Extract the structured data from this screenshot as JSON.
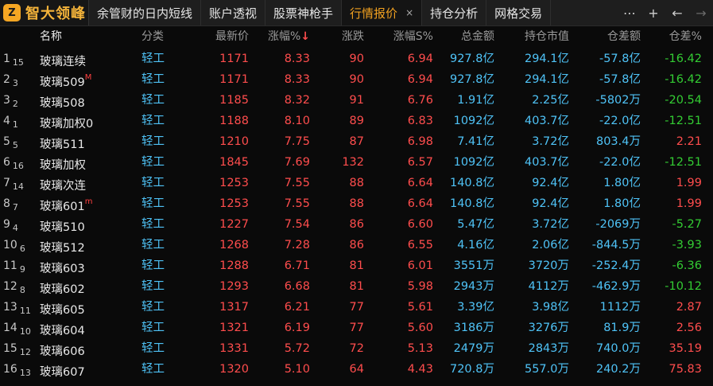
{
  "app": {
    "logo_text": "智大领峰",
    "logo_mark": "Z"
  },
  "tabs": [
    {
      "label": "余管财的日内短线",
      "active": false
    },
    {
      "label": "账户透视",
      "active": false
    },
    {
      "label": "股票神枪手",
      "active": false
    },
    {
      "label": "行情报价",
      "active": true,
      "close": "×"
    },
    {
      "label": "持仓分析",
      "active": false
    },
    {
      "label": "网格交易",
      "active": false
    }
  ],
  "toolbar": {
    "more": "⋯",
    "add": "+",
    "back": "←",
    "forward": "→"
  },
  "columns": {
    "name": "名称",
    "category": "分类",
    "price": "最新价",
    "change_pct": "涨幅%",
    "sort_indicator": "↓",
    "change": "涨跌",
    "amplitude": "涨幅S%",
    "amount": "总金额",
    "open_interest_value": "持仓市值",
    "oi_diff": "仓差额",
    "oi_change_pct": "仓差%"
  },
  "rows": [
    {
      "idx": "1",
      "sub": "15",
      "name": "玻璃连续",
      "mark": "",
      "cat": "轻工",
      "price": "1171",
      "pct": "8.33",
      "chg": "90",
      "amp": "6.94",
      "amount": "927.8亿",
      "oi": "294.1亿",
      "oidiff": "-57.8亿",
      "oichg": "-16.42",
      "oichg_dir": "down"
    },
    {
      "idx": "2",
      "sub": "3",
      "name": "玻璃509",
      "mark": "M",
      "cat": "轻工",
      "price": "1171",
      "pct": "8.33",
      "chg": "90",
      "amp": "6.94",
      "amount": "927.8亿",
      "oi": "294.1亿",
      "oidiff": "-57.8亿",
      "oichg": "-16.42",
      "oichg_dir": "down"
    },
    {
      "idx": "3",
      "sub": "2",
      "name": "玻璃508",
      "mark": "",
      "cat": "轻工",
      "price": "1185",
      "pct": "8.32",
      "chg": "91",
      "amp": "6.76",
      "amount": "1.91亿",
      "oi": "2.25亿",
      "oidiff": "-5802万",
      "oichg": "-20.54",
      "oichg_dir": "down"
    },
    {
      "idx": "4",
      "sub": "1",
      "name": "玻璃加权0",
      "mark": "",
      "cat": "轻工",
      "price": "1188",
      "pct": "8.10",
      "chg": "89",
      "amp": "6.83",
      "amount": "1092亿",
      "oi": "403.7亿",
      "oidiff": "-22.0亿",
      "oichg": "-12.51",
      "oichg_dir": "down"
    },
    {
      "idx": "5",
      "sub": "5",
      "name": "玻璃511",
      "mark": "",
      "cat": "轻工",
      "price": "1210",
      "pct": "7.75",
      "chg": "87",
      "amp": "6.98",
      "amount": "7.41亿",
      "oi": "3.72亿",
      "oidiff": "803.4万",
      "oichg": "2.21",
      "oichg_dir": "up"
    },
    {
      "idx": "6",
      "sub": "16",
      "name": "玻璃加权",
      "mark": "",
      "cat": "轻工",
      "price": "1845",
      "pct": "7.69",
      "chg": "132",
      "amp": "6.57",
      "amount": "1092亿",
      "oi": "403.7亿",
      "oidiff": "-22.0亿",
      "oichg": "-12.51",
      "oichg_dir": "down"
    },
    {
      "idx": "7",
      "sub": "14",
      "name": "玻璃次连",
      "mark": "",
      "cat": "轻工",
      "price": "1253",
      "pct": "7.55",
      "chg": "88",
      "amp": "6.64",
      "amount": "140.8亿",
      "oi": "92.4亿",
      "oidiff": "1.80亿",
      "oichg": "1.99",
      "oichg_dir": "up"
    },
    {
      "idx": "8",
      "sub": "7",
      "name": "玻璃601",
      "mark": "m",
      "cat": "轻工",
      "price": "1253",
      "pct": "7.55",
      "chg": "88",
      "amp": "6.64",
      "amount": "140.8亿",
      "oi": "92.4亿",
      "oidiff": "1.80亿",
      "oichg": "1.99",
      "oichg_dir": "up"
    },
    {
      "idx": "9",
      "sub": "4",
      "name": "玻璃510",
      "mark": "",
      "cat": "轻工",
      "price": "1227",
      "pct": "7.54",
      "chg": "86",
      "amp": "6.60",
      "amount": "5.47亿",
      "oi": "3.72亿",
      "oidiff": "-2069万",
      "oichg": "-5.27",
      "oichg_dir": "down"
    },
    {
      "idx": "10",
      "sub": "6",
      "name": "玻璃512",
      "mark": "",
      "cat": "轻工",
      "price": "1268",
      "pct": "7.28",
      "chg": "86",
      "amp": "6.55",
      "amount": "4.16亿",
      "oi": "2.06亿",
      "oidiff": "-844.5万",
      "oichg": "-3.93",
      "oichg_dir": "down"
    },
    {
      "idx": "11",
      "sub": "9",
      "name": "玻璃603",
      "mark": "",
      "cat": "轻工",
      "price": "1288",
      "pct": "6.71",
      "chg": "81",
      "amp": "6.01",
      "amount": "3551万",
      "oi": "3720万",
      "oidiff": "-252.4万",
      "oichg": "-6.36",
      "oichg_dir": "down"
    },
    {
      "idx": "12",
      "sub": "8",
      "name": "玻璃602",
      "mark": "",
      "cat": "轻工",
      "price": "1293",
      "pct": "6.68",
      "chg": "81",
      "amp": "5.98",
      "amount": "2943万",
      "oi": "4112万",
      "oidiff": "-462.9万",
      "oichg": "-10.12",
      "oichg_dir": "down"
    },
    {
      "idx": "13",
      "sub": "11",
      "name": "玻璃605",
      "mark": "",
      "cat": "轻工",
      "price": "1317",
      "pct": "6.21",
      "chg": "77",
      "amp": "5.61",
      "amount": "3.39亿",
      "oi": "3.98亿",
      "oidiff": "1112万",
      "oichg": "2.87",
      "oichg_dir": "up"
    },
    {
      "idx": "14",
      "sub": "10",
      "name": "玻璃604",
      "mark": "",
      "cat": "轻工",
      "price": "1321",
      "pct": "6.19",
      "chg": "77",
      "amp": "5.60",
      "amount": "3186万",
      "oi": "3276万",
      "oidiff": "81.9万",
      "oichg": "2.56",
      "oichg_dir": "up"
    },
    {
      "idx": "15",
      "sub": "12",
      "name": "玻璃606",
      "mark": "",
      "cat": "轻工",
      "price": "1331",
      "pct": "5.72",
      "chg": "72",
      "amp": "5.13",
      "amount": "2479万",
      "oi": "2843万",
      "oidiff": "740.0万",
      "oichg": "35.19",
      "oichg_dir": "up"
    },
    {
      "idx": "16",
      "sub": "13",
      "name": "玻璃607",
      "mark": "",
      "cat": "轻工",
      "price": "1320",
      "pct": "5.10",
      "chg": "64",
      "amp": "4.43",
      "amount": "720.8万",
      "oi": "557.0万",
      "oidiff": "240.2万",
      "oichg": "75.83",
      "oichg_dir": "up"
    }
  ],
  "colors": {
    "up": "#ff4d4d",
    "down": "#33cc33",
    "neutral": "#4fc3f7",
    "accent": "#f0a020"
  }
}
